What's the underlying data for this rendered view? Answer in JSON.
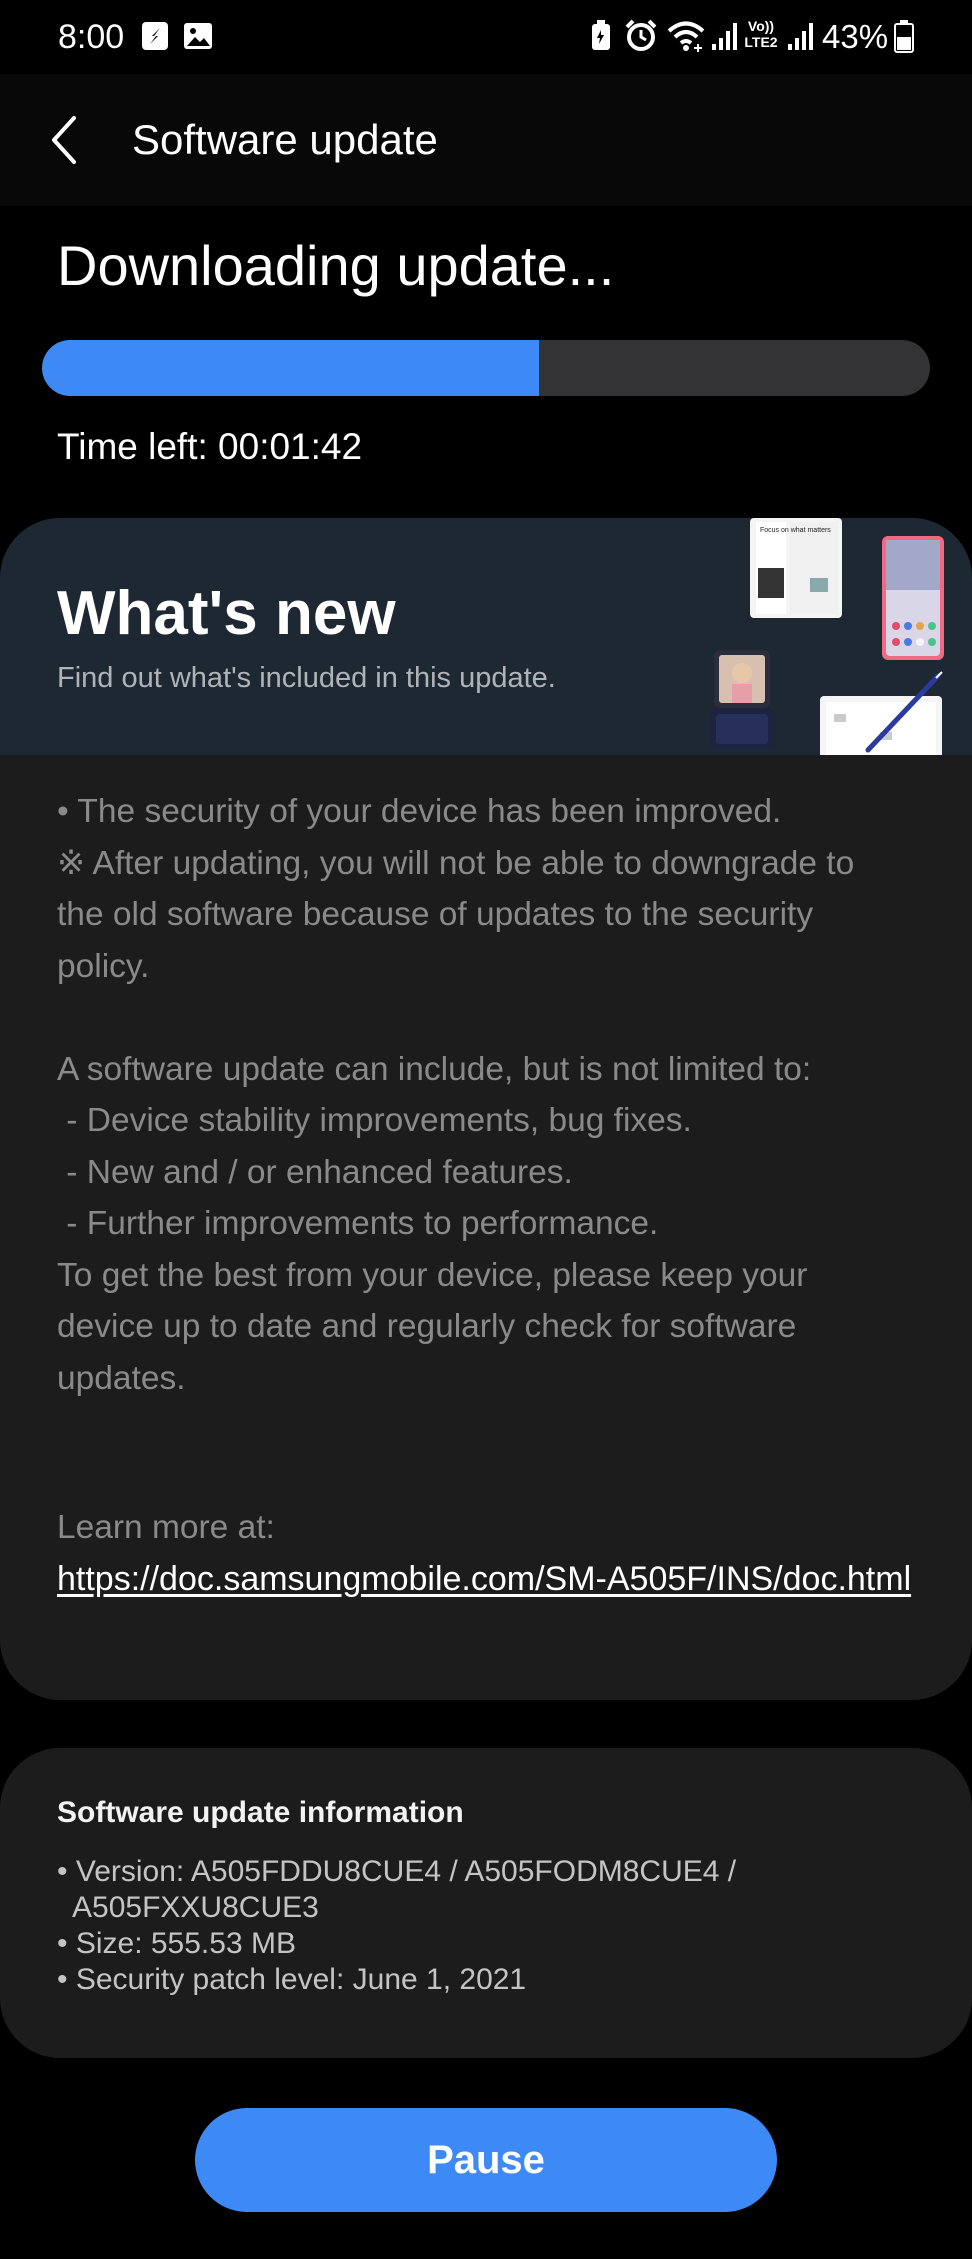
{
  "status_bar": {
    "time": "8:00",
    "battery": "43%",
    "volte_label": "Vo))",
    "lte_label": "LTE2",
    "icons": [
      "sync-icon",
      "image-icon",
      "battery-saver-icon",
      "alarm-icon",
      "wifi-icon",
      "signal-icon",
      "signal-icon",
      "battery-icon"
    ]
  },
  "app_bar": {
    "title": "Software update",
    "back_icon": "chevron-left-icon"
  },
  "download": {
    "title": "Downloading update...",
    "progress": 0.56,
    "time_left": "Time left: 00:01:42"
  },
  "whats_new": {
    "title": "What's new",
    "subtitle": "Find out what's included in this update.",
    "banner_phone_text": "Focus on what matters",
    "notes": [
      "• The security of your device has been improved.",
      "※ After updating, you will not be able to downgrade to",
      "the old software because of updates to the security",
      "policy.",
      "",
      "A software update can include, but is not limited to:",
      " - Device stability improvements, bug fixes.",
      " - New and / or enhanced features.",
      " - Further improvements to performance.",
      "To get the best from your device, please keep your",
      "device up to date and regularly check for software",
      "updates."
    ],
    "learn_more_label": "Learn more at:",
    "learn_more_url": "https://doc.samsungmobile.com/SM-A505F/INS/doc.html"
  },
  "update_info": {
    "title": "Software update information",
    "items": [
      "• Version: A505FDDU8CUE4 / A505FODM8CUE4 /",
      "  A505FXXU8CUE3",
      "• Size: 555.53 MB",
      "• Security patch level: June 1, 2021"
    ]
  },
  "actions": {
    "pause_label": "Pause"
  },
  "colors": {
    "accent": "#3d8af7",
    "background": "#000000",
    "card": "#1c1c1c",
    "banner": "#1d2832"
  }
}
